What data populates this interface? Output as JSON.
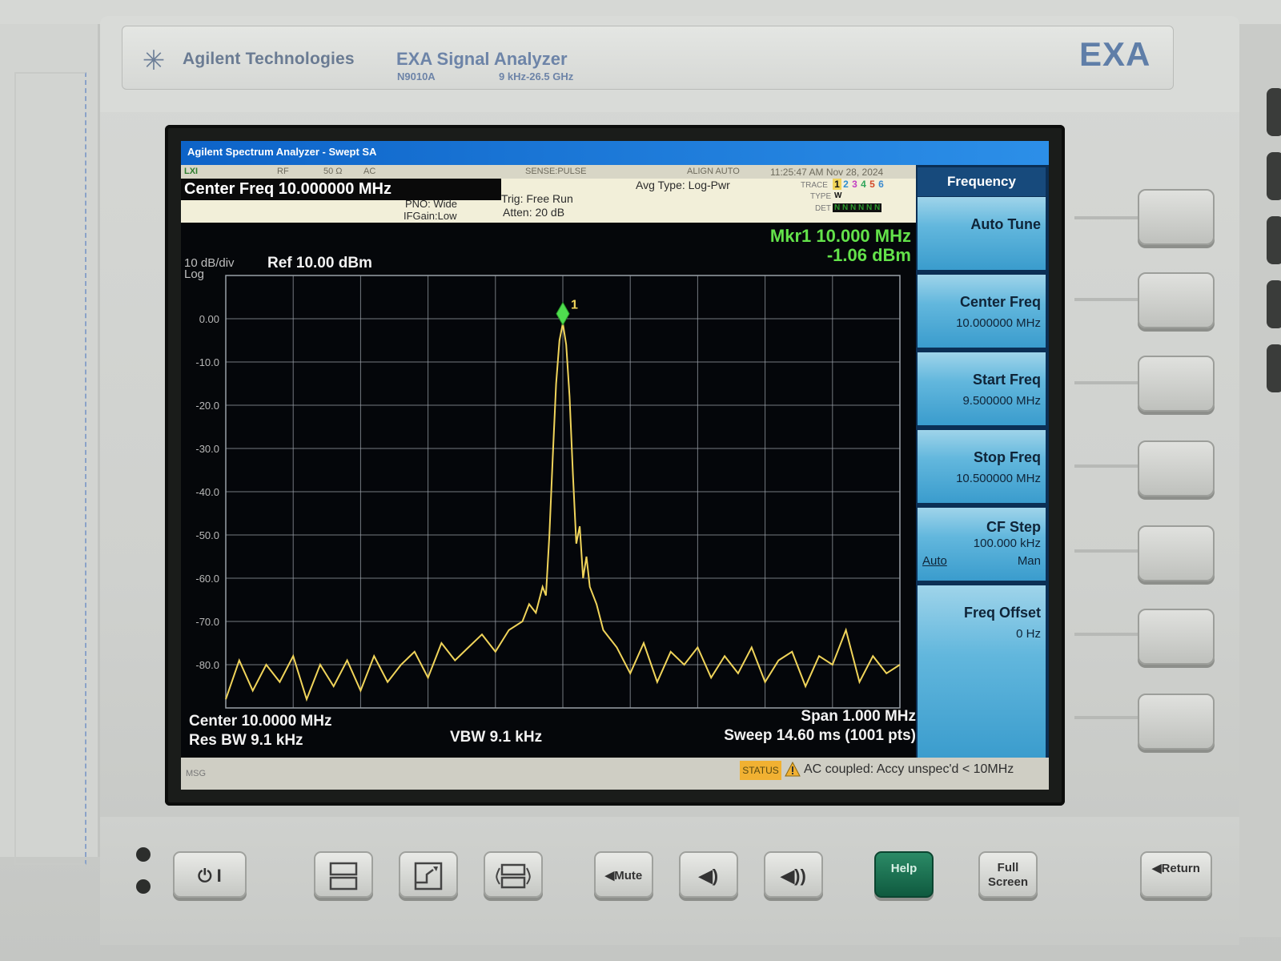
{
  "brand": {
    "logo_icon": "agilent-starburst-icon",
    "name": "Agilent Technologies",
    "model_name": "EXA Signal Analyzer",
    "model_number": "N9010A",
    "freq_range": "9 kHz-26.5 GHz",
    "badge": "EXA"
  },
  "titlebar": {
    "title": "Agilent Spectrum Analyzer - Swept SA"
  },
  "status_row": {
    "icon": "lxi-icon",
    "rf": "RF",
    "impedance": "50 Ω",
    "coupling": "AC",
    "sense": "SENSE:PULSE",
    "align": "ALIGN AUTO",
    "datetime": "11:25:47 AM Nov 28, 2024"
  },
  "info": {
    "center_freq": "Center Freq 10.000000 MHz",
    "pno": "PNO: Wide",
    "ifgain": "IFGain:Low",
    "trig": "Trig: Free Run",
    "atten": "Atten: 20 dB",
    "avg_type": "Avg Type: Log-Pwr",
    "trace_label": "TRACE",
    "trace_nums": [
      "1",
      "2",
      "3",
      "4",
      "5",
      "6"
    ],
    "type_label": "TYPE",
    "type_value": "W",
    "det_label": "DET",
    "det_value": "N N N N N N"
  },
  "graph": {
    "scale": "10 dB/div",
    "scale_type": "Log",
    "ref": "Ref 10.00 dBm",
    "marker_freq": "Mkr1 10.000 MHz",
    "marker_amp": "-1.06 dBm",
    "marker_label": "1",
    "y_ticks": [
      "0.00",
      "-10.0",
      "-20.0",
      "-30.0",
      "-40.0",
      "-50.0",
      "-60.0",
      "-70.0",
      "-80.0"
    ],
    "center": "Center 10.0000 MHz",
    "res_bw": "Res BW 9.1 kHz",
    "vbw": "VBW 9.1 kHz",
    "span": "Span 1.000 MHz",
    "sweep": "Sweep  14.60 ms (1001 pts)",
    "trace_color": "#f0d45a"
  },
  "chart_data": {
    "type": "line",
    "xlim": [
      9.5,
      10.5
    ],
    "ylim": [
      -90,
      10
    ],
    "grid": true,
    "marker": {
      "x": 10.0,
      "y": -1.06
    },
    "x": [
      9.5,
      9.52,
      9.54,
      9.56,
      9.58,
      9.6,
      9.62,
      9.64,
      9.66,
      9.68,
      9.7,
      9.72,
      9.74,
      9.76,
      9.78,
      9.8,
      9.82,
      9.84,
      9.86,
      9.88,
      9.9,
      9.92,
      9.94,
      9.95,
      9.96,
      9.97,
      9.975,
      9.98,
      9.985,
      9.99,
      9.995,
      10.0,
      10.005,
      10.01,
      10.015,
      10.02,
      10.025,
      10.03,
      10.035,
      10.04,
      10.05,
      10.06,
      10.08,
      10.1,
      10.12,
      10.14,
      10.16,
      10.18,
      10.2,
      10.22,
      10.24,
      10.26,
      10.28,
      10.3,
      10.32,
      10.34,
      10.36,
      10.38,
      10.4,
      10.42,
      10.44,
      10.46,
      10.48,
      10.5
    ],
    "values": [
      -88,
      -79,
      -86,
      -80,
      -84,
      -78,
      -88,
      -80,
      -85,
      -79,
      -86,
      -78,
      -84,
      -80,
      -77,
      -83,
      -75,
      -79,
      -76,
      -73,
      -77,
      -72,
      -70,
      -66,
      -68,
      -62,
      -64,
      -50,
      -32,
      -15,
      -5,
      -1.06,
      -6,
      -18,
      -36,
      -52,
      -48,
      -60,
      -55,
      -62,
      -66,
      -72,
      -76,
      -82,
      -75,
      -84,
      -77,
      -80,
      -76,
      -83,
      -78,
      -82,
      -76,
      -84,
      -79,
      -77,
      -85,
      -78,
      -80,
      -72,
      -84,
      -78,
      -82,
      -80
    ]
  },
  "softkeys": {
    "title": "Frequency",
    "auto_tune": "Auto Tune",
    "center_freq": {
      "label": "Center Freq",
      "value": "10.000000 MHz"
    },
    "start_freq": {
      "label": "Start Freq",
      "value": "9.500000 MHz"
    },
    "stop_freq": {
      "label": "Stop Freq",
      "value": "10.500000 MHz"
    },
    "cf_step": {
      "label": "CF Step",
      "value": "100.000 kHz",
      "auto": "Auto",
      "man": "Man"
    },
    "freq_offset": {
      "label": "Freq Offset",
      "value": "0 Hz"
    }
  },
  "message_bar": {
    "msg_label": "MSG",
    "status_label": "STATUS",
    "warning_icon": "warning-triangle-icon",
    "message": "AC coupled: Accy unspec'd < 10MHz"
  },
  "hard_keys": {
    "power": "⏻ I",
    "mute": "Mute",
    "help": "Help",
    "full_screen": "Full Screen",
    "return": "Return"
  }
}
